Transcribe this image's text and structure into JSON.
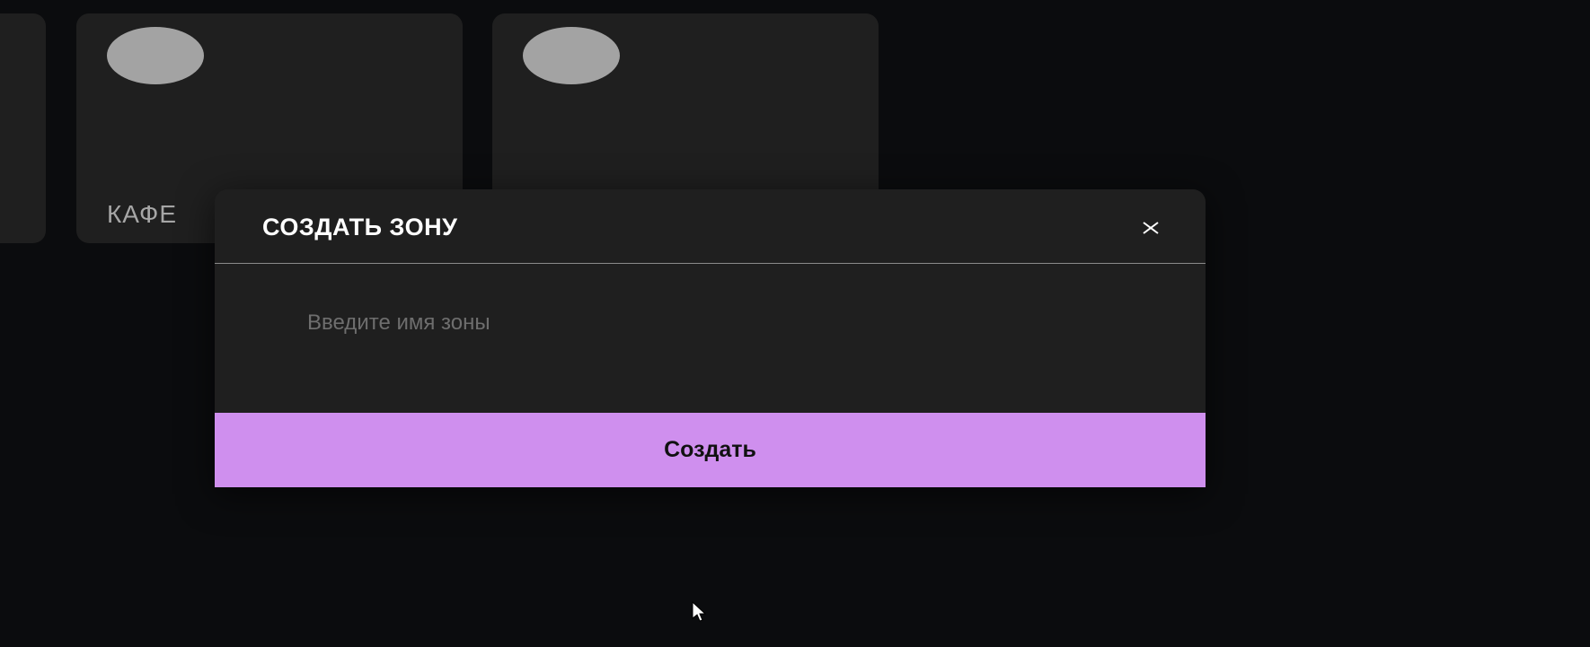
{
  "cards": [
    {
      "label": ""
    },
    {
      "label": "КАФЕ"
    },
    {
      "label": ""
    }
  ],
  "modal": {
    "title": "СОЗДАТЬ ЗОНУ",
    "close_icon": "close-icon",
    "input": {
      "value": "",
      "placeholder": "Введите имя зоны"
    },
    "submit_label": "Создать"
  },
  "colors": {
    "background": "#0b0c0e",
    "card": "#1f1f1f",
    "modal": "#1f1f1f",
    "accent": "#cf8fee",
    "avatar": "#a3a3a3"
  }
}
